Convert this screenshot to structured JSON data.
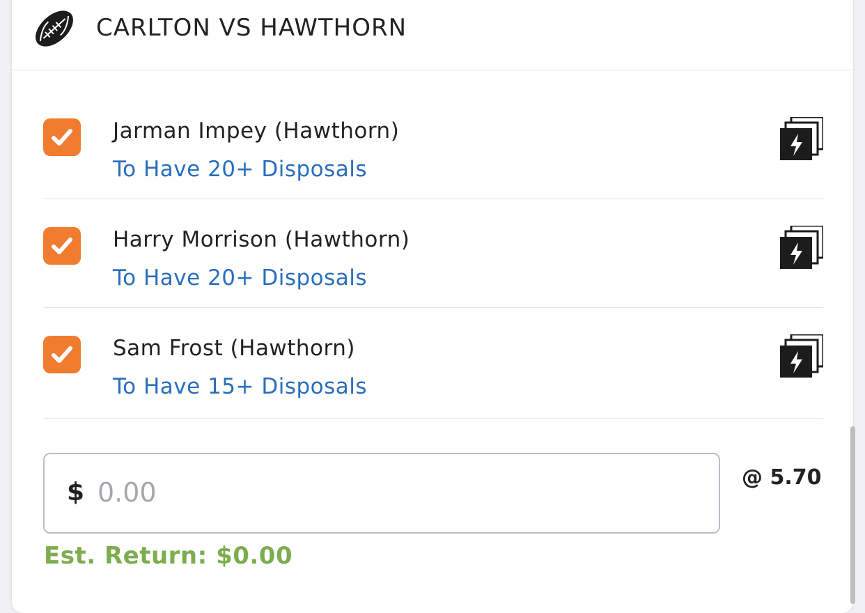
{
  "match": {
    "title": "CARLTON VS HAWTHORN",
    "sport_icon": "football-icon"
  },
  "legs": [
    {
      "checked": true,
      "player": "Jarman Impey (Hawthorn)",
      "market": "To Have 20+ Disposals",
      "icon": "same-game-multi-icon"
    },
    {
      "checked": true,
      "player": "Harry Morrison (Hawthorn)",
      "market": "To Have 20+ Disposals",
      "icon": "same-game-multi-icon"
    },
    {
      "checked": true,
      "player": "Sam Frost (Hawthorn)",
      "market": "To Have 15+ Disposals",
      "icon": "same-game-multi-icon"
    }
  ],
  "stake": {
    "currency": "$",
    "value": "",
    "placeholder": "0.00"
  },
  "odds": "@ 5.70",
  "est_return": "Est. Return: $0.00",
  "colors": {
    "checkbox": "#f07c30",
    "market_link": "#2a6ebd",
    "est_return": "#7cad4f",
    "text": "#222222"
  }
}
